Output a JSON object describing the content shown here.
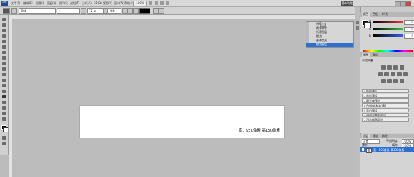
{
  "menubar": {
    "logo": "Ps",
    "menus": [
      "文件(F)",
      "编辑(E)",
      "图像(I)",
      "图层(L)",
      "选择(S)",
      "滤镜(T)",
      "分析(A)",
      "3D(D)",
      "视图(V)",
      "窗口(W)",
      "帮助(H)"
    ],
    "zoom": "100%",
    "workspace_button": "基本功能"
  },
  "options": {
    "font_family": "黑体",
    "font_style": "-",
    "font_size": "72 点",
    "antialias": "锐利"
  },
  "history": {
    "items": [
      "新建",
      "横排文字",
      "新建图层",
      "描边",
      "选择工具",
      "描边图层"
    ],
    "selected_index": 5
  },
  "color_panel": {
    "tabs": [
      "颜色",
      "色板",
      "样式"
    ],
    "channels": [
      {
        "label": "R",
        "value": "0",
        "color": "#e53b3b"
      },
      {
        "label": "G",
        "value": "0",
        "color": "#3bbf3b"
      },
      {
        "label": "B",
        "value": "0",
        "color": "#3b5fe5"
      }
    ]
  },
  "adjustments": {
    "tabs": [
      "调整",
      "蒙版"
    ],
    "title": "添加调整",
    "presets": [
      "色阶预设",
      "曲线预设",
      "曝光度预设",
      "色相/饱和度预设",
      "黑白预设",
      "通道混合器预设",
      "可选颜色预设"
    ]
  },
  "layers": {
    "tabs": [
      "图层",
      "通道",
      "路径"
    ],
    "blend_mode": "正常",
    "opacity_label": "不透明度:",
    "opacity": "100%",
    "lock_label": "锁定:",
    "fill_label": "填充:",
    "fill": "100%",
    "layer_thumb": "T",
    "layer_name": "宽：950像素 高150像素"
  },
  "canvas": {
    "text": "宽：950像素 高150像素"
  }
}
